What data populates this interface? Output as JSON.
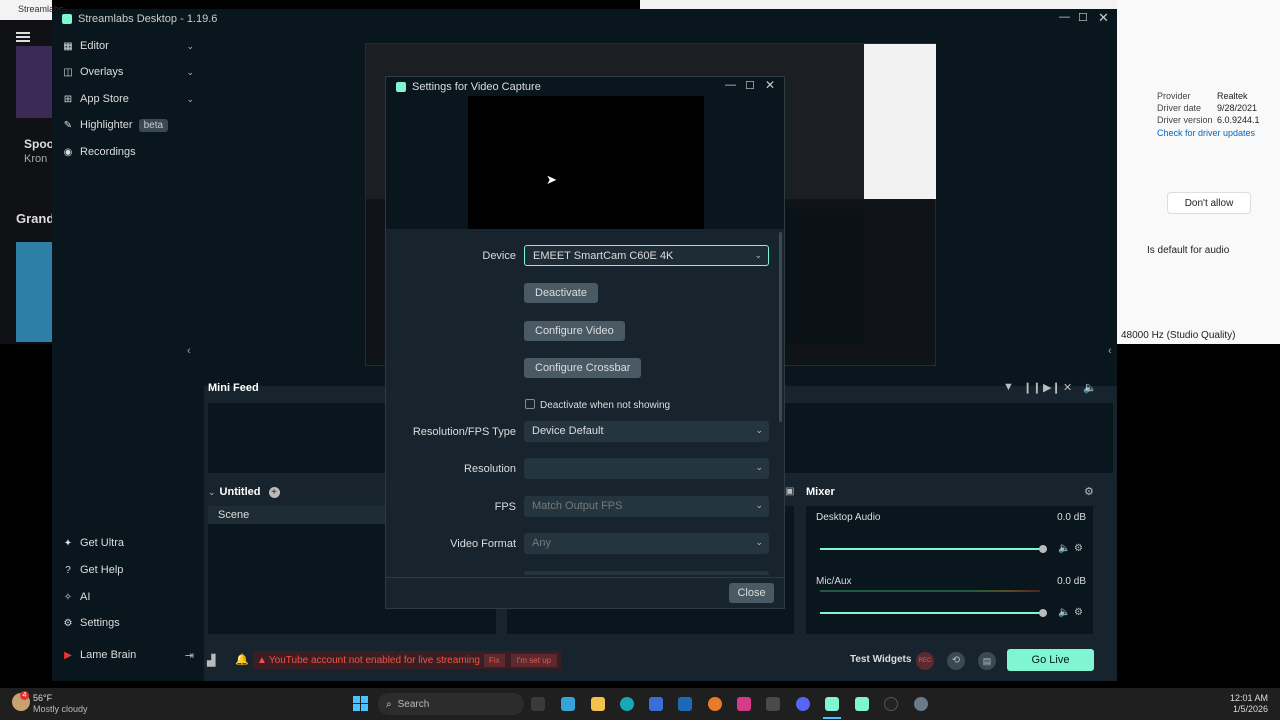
{
  "desktop": {
    "left_window_title": "Streamlabs",
    "left_sidebar_text": [
      "Spool",
      "Kron",
      "Grand"
    ],
    "right_panel": {
      "provider_label": "Provider",
      "provider_value": "Realtek",
      "driver_date_label": "Driver date",
      "driver_date_value": "9/28/2021",
      "driver_version_label": "Driver version",
      "driver_version_value": "6.0.9244.1",
      "check_updates_link": "Check for driver updates",
      "dont_allow_button": "Don't allow",
      "default_audio_select": "Is default for audio",
      "sample_rate_select": "48000 Hz (Studio Quality)"
    }
  },
  "app": {
    "title": "Streamlabs Desktop - 1.19.6",
    "accent": "#80f5d2"
  },
  "sidebar": {
    "items": [
      {
        "label": "Editor",
        "icon": "editor-icon"
      },
      {
        "label": "Overlays",
        "icon": "overlays-icon"
      },
      {
        "label": "App Store",
        "icon": "app-store-icon"
      },
      {
        "label": "Highlighter",
        "icon": "highlighter-icon",
        "badge": "beta"
      },
      {
        "label": "Recordings",
        "icon": "recordings-icon"
      }
    ],
    "bottom_items": [
      {
        "label": "Get Ultra"
      },
      {
        "label": "Get Help"
      },
      {
        "label": "AI"
      },
      {
        "label": "Settings"
      },
      {
        "label": "Lame Brain"
      }
    ]
  },
  "editor": {
    "mini_feed_title": "Mini Feed",
    "scene_collection": "Untitled",
    "scene_header": "Scene",
    "mixer_title": "Mixer",
    "mixer_channels": [
      {
        "name": "Desktop Audio",
        "level": "0.0 dB",
        "volume": 0.95
      },
      {
        "name": "Mic/Aux",
        "level": "0.0 dB",
        "volume": 0.95
      }
    ]
  },
  "footer": {
    "warning_text": "YouTube account not enabled for live streaming",
    "fix_button": "Fix",
    "set_up_button": "I'm set up",
    "test_widgets": "Test Widgets",
    "rec_label": "REC",
    "go_live": "Go Live"
  },
  "dialog": {
    "title": "Settings for Video Capture",
    "device_label": "Device",
    "device_value": "EMEET SmartCam C60E 4K",
    "deactivate_button": "Deactivate",
    "configure_video_button": "Configure Video",
    "configure_crossbar_button": "Configure Crossbar",
    "deactivate_checkbox_label": "Deactivate when not showing",
    "resolution_fps_label": "Resolution/FPS Type",
    "resolution_fps_value": "Device Default",
    "resolution_label": "Resolution",
    "resolution_value": "",
    "fps_label": "FPS",
    "fps_value": "Match Output FPS",
    "video_format_label": "Video Format",
    "video_format_value": "Any",
    "close_button": "Close"
  },
  "taskbar": {
    "weather_temp": "56°F",
    "weather_desc": "Mostly cloudy",
    "search_placeholder": "Search",
    "time": "12:01 AM",
    "date": "1/5/2026"
  }
}
